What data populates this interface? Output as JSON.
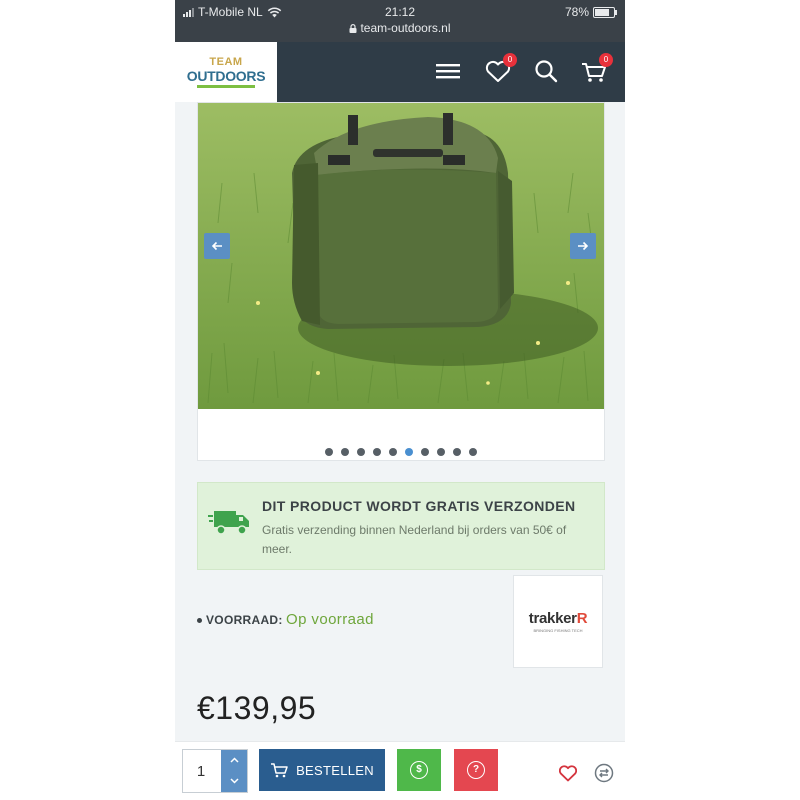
{
  "status_bar": {
    "carrier": "T-Mobile NL",
    "time": "21:12",
    "battery": "78%",
    "battery_level": 0.78,
    "url": "team-outdoors.nl",
    "icons": [
      "signal-icon",
      "wifi-icon",
      "lock-icon",
      "battery-icon"
    ]
  },
  "header": {
    "logo": {
      "line1": "TEAM",
      "line2": "OUTDOORS"
    },
    "menu_icon": "hamburger-icon",
    "wishlist": {
      "icon": "heart-icon",
      "count": "0"
    },
    "search_icon": "search-icon",
    "cart": {
      "icon": "cart-icon",
      "count": "0"
    }
  },
  "gallery": {
    "image_alt": "Groene tas op het gras",
    "prev_icon": "arrow-left-icon",
    "next_icon": "arrow-right-icon",
    "dot_count": 10,
    "active_dot": 6
  },
  "shipping": {
    "icon": "truck-icon",
    "title": "DIT PRODUCT WORDT GRATIS VERZONDEN",
    "text": "Gratis verzending binnen Nederland bij orders van 50€ of meer."
  },
  "stock": {
    "label": "VOORRAAD:",
    "value": "Op voorraad"
  },
  "brand": {
    "name_main": "trakker",
    "name_r": "R",
    "tagline": "BRINGING FISHING TECH"
  },
  "price": "€139,95",
  "bottom_bar": {
    "quantity": "1",
    "order_label": "BESTELLEN",
    "order_icon": "cart-icon",
    "green_button_icon": "dollar-icon",
    "green_button_symbol": "$",
    "red_button_icon": "question-icon",
    "red_button_symbol": "?",
    "wishlist_icon": "heart-outline-icon",
    "compare_icon": "compare-icon"
  },
  "colors": {
    "header_bg": "#2f3c47",
    "badge": "#e8313b",
    "accent_blue": "#2a5d8f",
    "slider_blue": "#5b8fc4",
    "shipping_bg": "#e0f2da",
    "stock_green": "#6ea63b",
    "button_green": "#4fb84a",
    "button_red": "#e44750"
  }
}
